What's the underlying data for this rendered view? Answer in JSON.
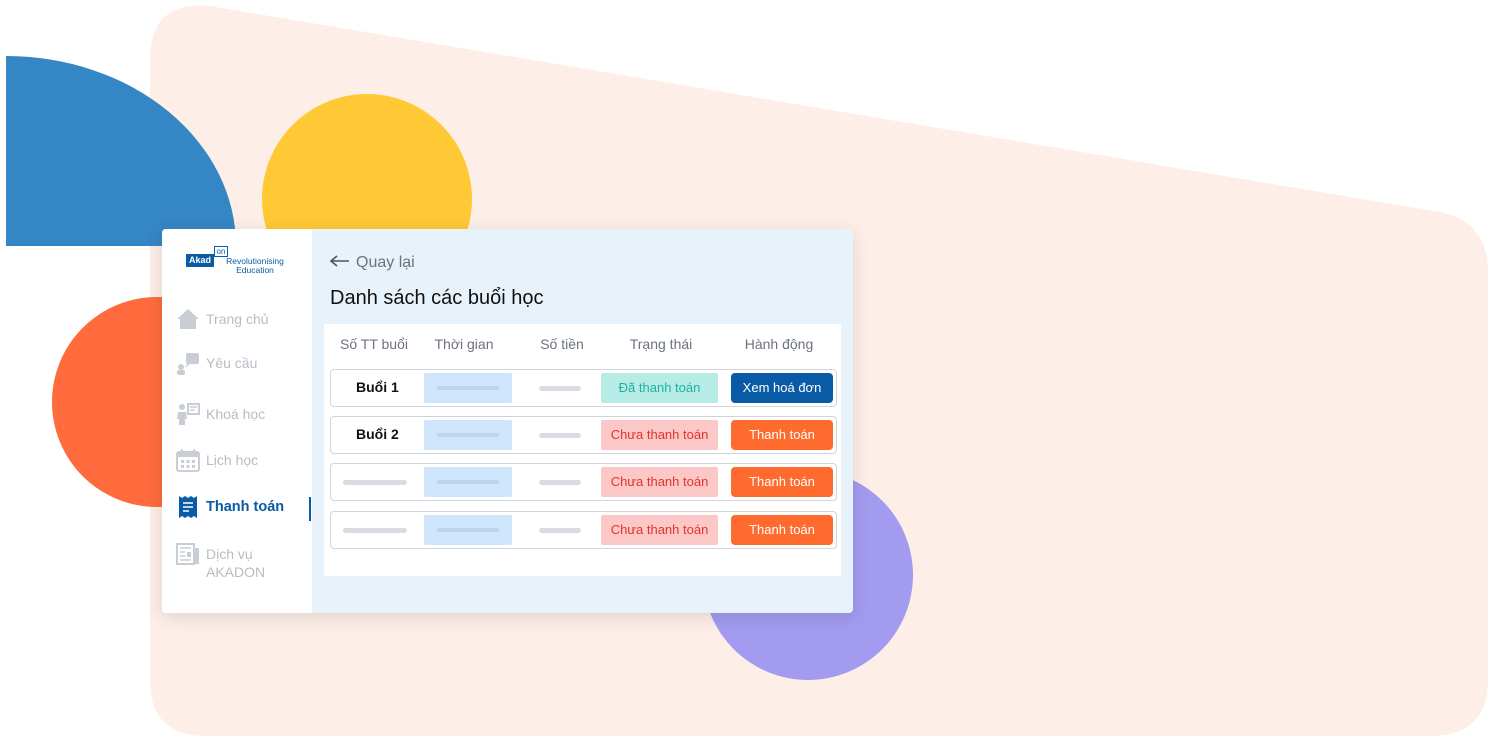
{
  "colors": {
    "brand_blue": "#0A5BA5",
    "accent_orange": "#FF6B2E",
    "paid_text": "#1BB39E",
    "unpaid_text": "#E5332A",
    "bg_peach": "#FDEFE7",
    "circle_blue": "#3586C4",
    "circle_yellow": "#FFC935",
    "circle_red": "#FF6B3D",
    "circle_purple": "#A29BF0"
  },
  "logo": {
    "box_text": "Akad",
    "on_text": "on",
    "subtitle_line1": "Revolutionising",
    "subtitle_line2": "Education"
  },
  "sidebar": {
    "items": [
      {
        "label": "Trang chủ",
        "icon": "home-icon"
      },
      {
        "label": "Yêu cầu",
        "icon": "request-icon"
      },
      {
        "label": "Khoá học",
        "icon": "course-icon"
      },
      {
        "label": "Lịch học",
        "icon": "calendar-icon"
      },
      {
        "label": "Thanh toán",
        "icon": "receipt-icon",
        "active": true
      },
      {
        "label_line1": "Dịch vụ",
        "label_line2": "AKADON",
        "icon": "newspaper-icon"
      }
    ]
  },
  "header": {
    "back_label": "Quay lại",
    "title": "Danh sách các buổi học"
  },
  "table": {
    "columns": [
      "Số TT buổi",
      "Thời gian",
      "Số tiền",
      "Trạng thái",
      "Hành động"
    ],
    "rows": [
      {
        "session": "Buổi 1",
        "status": "Đã thanh toán",
        "status_type": "paid",
        "action": "Xem hoá đơn",
        "action_type": "invoice"
      },
      {
        "session": "Buổi 2",
        "status": "Chưa thanh toán",
        "status_type": "unpaid",
        "action": "Thanh toán",
        "action_type": "pay"
      },
      {
        "session": "",
        "status": "Chưa thanh toán",
        "status_type": "unpaid",
        "action": "Thanh toán",
        "action_type": "pay"
      },
      {
        "session": "",
        "status": "Chưa thanh toán",
        "status_type": "unpaid",
        "action": "Thanh toán",
        "action_type": "pay"
      }
    ]
  }
}
